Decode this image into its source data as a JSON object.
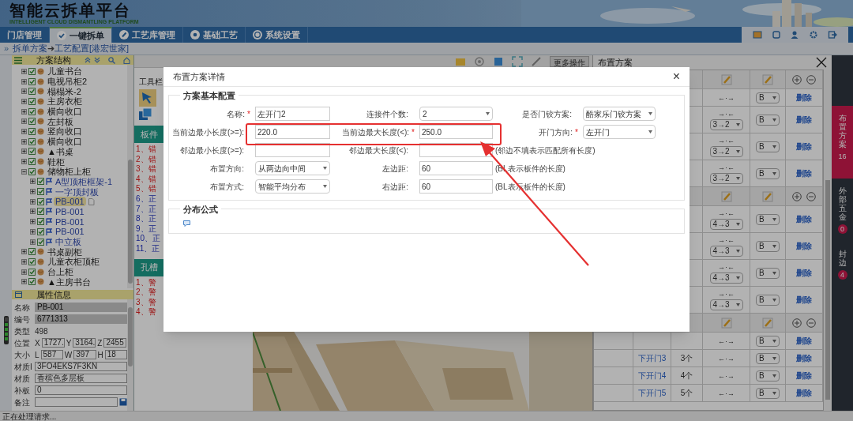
{
  "header": {
    "title": "智能云拆单平台",
    "subtitle": "INTELLIGENT CLOUD DISMANTLING PLATFORM"
  },
  "nav_tabs": [
    {
      "label": "门店管理",
      "selected": false
    },
    {
      "label": "一键拆单",
      "selected": true
    },
    {
      "label": "工艺库管理",
      "selected": false
    },
    {
      "label": "基础工艺",
      "selected": false
    },
    {
      "label": "系统设置",
      "selected": false
    }
  ],
  "breadcrumb": {
    "expander": "»",
    "parts": [
      "拆单方案",
      "工艺配置[港宏世家]"
    ],
    "separator": "➜"
  },
  "tree": {
    "title": "方案结构",
    "items": [
      {
        "label": "儿童书台",
        "kind": "cabinet",
        "checked": true,
        "expanded": false,
        "selected": false
      },
      {
        "label": "电视吊柜2",
        "kind": "cabinet",
        "checked": true,
        "expanded": false,
        "selected": false
      },
      {
        "label": "榻榻米-2",
        "kind": "cabinet",
        "checked": true,
        "expanded": false,
        "selected": false
      },
      {
        "label": "主房衣柜",
        "kind": "cabinet",
        "checked": true,
        "expanded": false,
        "selected": false
      },
      {
        "label": "横向收口",
        "kind": "cabinet",
        "checked": true,
        "expanded": false,
        "selected": false
      },
      {
        "label": "左封板",
        "kind": "cabinet",
        "checked": true,
        "expanded": false,
        "selected": false
      },
      {
        "label": "竖向收口",
        "kind": "cabinet",
        "checked": true,
        "expanded": false,
        "selected": false
      },
      {
        "label": "横向收口",
        "kind": "cabinet",
        "checked": true,
        "expanded": false,
        "selected": false
      },
      {
        "label": "▲书桌",
        "kind": "cabinet",
        "checked": true,
        "expanded": false,
        "selected": false
      },
      {
        "label": "鞋柜",
        "kind": "cabinet",
        "checked": true,
        "expanded": false,
        "selected": false
      },
      {
        "label": "储物柜上柜",
        "kind": "cabinet",
        "checked": true,
        "expanded": true,
        "selected": false,
        "children": [
          {
            "label": "A型顶柜框架-1",
            "kind": "panel",
            "checked": true,
            "expanded": false,
            "selected": false
          },
          {
            "label": "一字顶封板",
            "kind": "panel",
            "checked": true,
            "expanded": false,
            "selected": false
          },
          {
            "label": "PB-001",
            "kind": "panel",
            "checked": true,
            "expanded": false,
            "selected": true
          },
          {
            "label": "PB-001",
            "kind": "panel",
            "checked": true,
            "expanded": false,
            "selected": false
          },
          {
            "label": "PB-001",
            "kind": "panel",
            "checked": true,
            "expanded": false,
            "selected": false
          },
          {
            "label": "PB-001",
            "kind": "panel",
            "checked": true,
            "expanded": false,
            "selected": false
          },
          {
            "label": "中立板",
            "kind": "panel",
            "checked": true,
            "expanded": false,
            "selected": false
          }
        ]
      },
      {
        "label": "书桌副柜",
        "kind": "cabinet",
        "checked": true,
        "expanded": false,
        "selected": false
      },
      {
        "label": "儿童衣柜顶柜",
        "kind": "cabinet",
        "checked": true,
        "expanded": false,
        "selected": false
      },
      {
        "label": "台上柜",
        "kind": "cabinet",
        "checked": true,
        "expanded": false,
        "selected": false
      },
      {
        "label": "▲主房书台",
        "kind": "cabinet",
        "checked": true,
        "expanded": false,
        "selected": false
      }
    ]
  },
  "properties": {
    "title": "属性信息",
    "rows": [
      {
        "label": "名称",
        "kind": "readonly",
        "value": "PB-001"
      },
      {
        "label": "编号",
        "kind": "readonly",
        "value": "6771313"
      },
      {
        "label": "类型",
        "kind": "plain",
        "value": "498"
      },
      {
        "label": "位置",
        "kind": "triple",
        "parts": [
          {
            "axis": "X",
            "value": "1727."
          },
          {
            "axis": "Y",
            "value": "3164."
          },
          {
            "axis": "Z",
            "value": "2455"
          }
        ]
      },
      {
        "label": "大小",
        "kind": "triple",
        "parts": [
          {
            "axis": "L",
            "value": "587"
          },
          {
            "axis": "W",
            "value": "397"
          },
          {
            "axis": "H",
            "value": "18"
          }
        ]
      },
      {
        "label": "材质I",
        "kind": "input",
        "value": "3FO4EKS7F3KN"
      },
      {
        "label": "材质",
        "kind": "input",
        "value": "香槟色多层板"
      },
      {
        "label": "补板",
        "kind": "input",
        "value": "0"
      },
      {
        "label": "备注",
        "kind": "save"
      }
    ]
  },
  "work_panel": {
    "toolbar_label": "工具栏",
    "sections": [
      {
        "title": "板件",
        "items": [
          {
            "text": "1、错",
            "kind": "error"
          },
          {
            "text": "2、错",
            "kind": "error"
          },
          {
            "text": "3、错",
            "kind": "error"
          },
          {
            "text": "4、错",
            "kind": "error"
          },
          {
            "text": "5、错",
            "kind": "error"
          },
          {
            "text": "6、正",
            "kind": "normal"
          },
          {
            "text": "7、正",
            "kind": "normal"
          },
          {
            "text": "8、正",
            "kind": "normal"
          },
          {
            "text": "9、正",
            "kind": "normal"
          },
          {
            "text": "10、正",
            "kind": "normal"
          },
          {
            "text": "11、正",
            "kind": "normal"
          }
        ]
      },
      {
        "title": "孔槽",
        "items": [
          {
            "text": "1、警",
            "kind": "error"
          },
          {
            "text": "2、警",
            "kind": "error"
          },
          {
            "text": "3、警",
            "kind": "error"
          },
          {
            "text": "4、警",
            "kind": "error"
          }
        ]
      }
    ]
  },
  "view_toolbar": {
    "more_button": "更多操作"
  },
  "layout_panel": {
    "title": "布置方案",
    "rows": [
      {
        "kind": "group"
      },
      {
        "kind": "simple",
        "direction": "←·→",
        "side": "B",
        "action": "删除"
      },
      {
        "kind": "dual",
        "direction": "→·←",
        "order": "3→2",
        "side": "B",
        "action": "删除"
      },
      {
        "kind": "dual",
        "direction": "→·←",
        "order": "3→2",
        "side": "B",
        "action": "删除"
      },
      {
        "kind": "dual",
        "direction": "→·←",
        "order": "3→2",
        "side": "B",
        "action": "删除"
      },
      {
        "kind": "group"
      },
      {
        "kind": "dual",
        "direction": "→·←",
        "order": "4→3",
        "side": "B",
        "action": "删除"
      },
      {
        "kind": "dual",
        "direction": "→·←",
        "order": "4→3",
        "side": "B",
        "action": "删除"
      },
      {
        "kind": "dual",
        "direction": "→·←",
        "order": "4→3",
        "side": "B",
        "action": "删除"
      },
      {
        "kind": "dual",
        "direction": "→·←",
        "order": "4→3",
        "side": "B",
        "action": "删除"
      },
      {
        "kind": "group"
      },
      {
        "kind": "simple",
        "direction": "←·→",
        "side": "B",
        "action": "删除"
      },
      {
        "kind": "simple",
        "name": "下开门3",
        "count": "3个",
        "direction": "←·→",
        "side": "B",
        "action": "删除"
      },
      {
        "kind": "simple",
        "name": "下开门4",
        "count": "4个",
        "direction": "←·→",
        "side": "B",
        "action": "删除"
      },
      {
        "kind": "simple",
        "name": "下开门5",
        "count": "5个",
        "direction": "←·→",
        "side": "B",
        "action": "删除"
      }
    ]
  },
  "side_tabs": [
    {
      "label": "布置方案",
      "count": "16",
      "selected": true
    },
    {
      "label": "外部五金",
      "count": "0",
      "selected": false
    },
    {
      "label": "封边",
      "count": "4",
      "selected": false
    }
  ],
  "dialog": {
    "title": "布置方案详情",
    "close": "×",
    "sections": [
      {
        "title": "方案基本配置",
        "rows": [
          [
            {
              "label": "名称:",
              "required_mark": "*",
              "kind": "input",
              "value": "左开门2"
            },
            {
              "label": "连接件个数:",
              "kind": "select",
              "value": "2"
            },
            {
              "label": "是否门铰方案:",
              "kind": "select",
              "value": "酷家乐门铰方案"
            }
          ],
          [
            {
              "label": "当前边最小长度(>=):",
              "kind": "input",
              "value": "220.0"
            },
            {
              "label": "当前边最大长度(<):",
              "required_mark": "*",
              "kind": "input",
              "value": "250.0"
            },
            {
              "label": "开门方向:",
              "required_mark": "*",
              "kind": "select",
              "value": "左开门"
            }
          ],
          [
            {
              "label": "邻边最小长度(>=):",
              "kind": "input"
            },
            {
              "label": "邻边最大长度(<):",
              "kind": "input",
              "note": "(邻边不填表示匹配所有长度)"
            }
          ],
          [
            {
              "label": "布置方向:",
              "kind": "select",
              "value": "从两边向中间"
            },
            {
              "label": "左边距:",
              "kind": "input",
              "value": "60",
              "note": "(BL表示板件的长度)"
            }
          ],
          [
            {
              "label": "布置方式:",
              "kind": "select",
              "value": "智能平均分布"
            },
            {
              "label": "右边距:",
              "kind": "input",
              "value": "60",
              "note": "(BL表示板件的长度)"
            }
          ]
        ]
      },
      {
        "title": "分布公式"
      }
    ]
  },
  "status_bar": "正在处理请求..."
}
